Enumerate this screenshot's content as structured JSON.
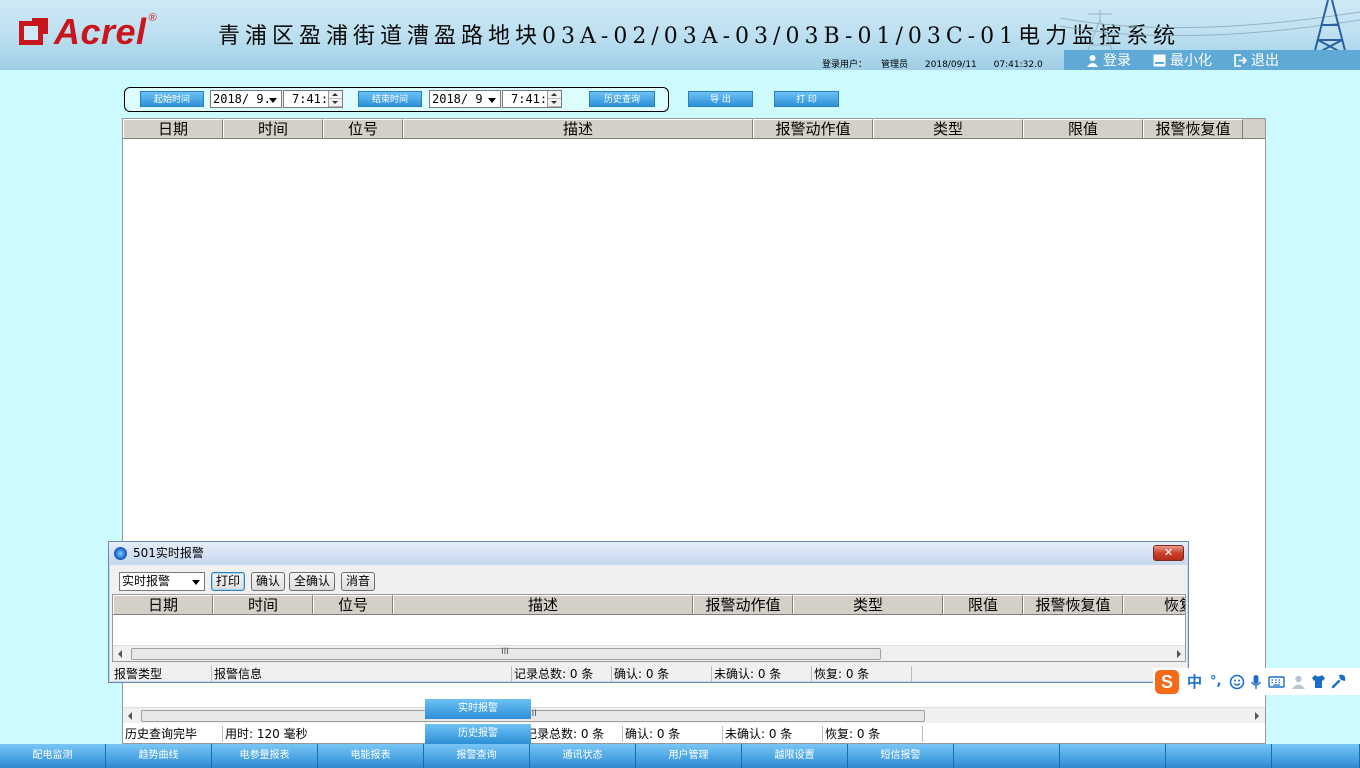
{
  "header": {
    "logo_text": "Acrel",
    "logo_reg": "®",
    "title": "青浦区盈浦街道漕盈路地块03A-02/03A-03/03B-01/03C-01电力监控系统",
    "login_user_label": "登录用户：",
    "login_user": "管理员",
    "date": "2018/09/11",
    "time": "07:41:32.0",
    "actions": [
      {
        "label": "登录"
      },
      {
        "label": "最小化"
      },
      {
        "label": "退出"
      }
    ]
  },
  "query": {
    "start_label": "起始时间",
    "start_date": "2018/ 9.",
    "start_time": "7:41:",
    "end_label": "结束时间",
    "end_date": "2018/ 9",
    "end_time": "7:41:",
    "query_button": "历史查询",
    "export_button": "导  出",
    "print_button": "打  印"
  },
  "main_table": {
    "columns": [
      "日期",
      "时间",
      "位号",
      "描述",
      "报警动作值",
      "类型",
      "限值",
      "报警恢复值"
    ],
    "rows": [],
    "status": {
      "state": "历史查询完毕",
      "elapsed": "用时: 120 毫秒",
      "total": "记录总数: 0 条",
      "confirmed": "确认: 0 条",
      "unconfirmed": "未确认: 0 条",
      "recovered": "恢复: 0 条"
    }
  },
  "alarm_window": {
    "title": "501实时报警",
    "close": "✕",
    "filter_value": "实时报警",
    "buttons": [
      "打印",
      "确认",
      "全确认",
      "消音"
    ],
    "columns": [
      "日期",
      "时间",
      "位号",
      "描述",
      "报警动作值",
      "类型",
      "限值",
      "报警恢复值",
      "恢复"
    ],
    "rows": [],
    "status": {
      "type_label": "报警类型",
      "info_label": "报警信息",
      "total": "记录总数: 0 条",
      "confirmed": "确认: 0 条",
      "unconfirmed": "未确认: 0 条",
      "recovered": "恢复: 0 条"
    }
  },
  "ime": {
    "logo": "S",
    "mode": "中",
    "punct": "°,"
  },
  "float_buttons": {
    "realtime": "实时报警",
    "history": "历史报警"
  },
  "bottom_nav": [
    "配电监测",
    "趋势曲线",
    "电参量报表",
    "电能报表",
    "报警查询",
    "通讯状态",
    "用户管理",
    "越限设置",
    "短信报警",
    "",
    "",
    "",
    ""
  ],
  "colors": {
    "background": "#cdfafc",
    "accent_blue": "#2d91d6",
    "brand_red": "#c9151e"
  }
}
